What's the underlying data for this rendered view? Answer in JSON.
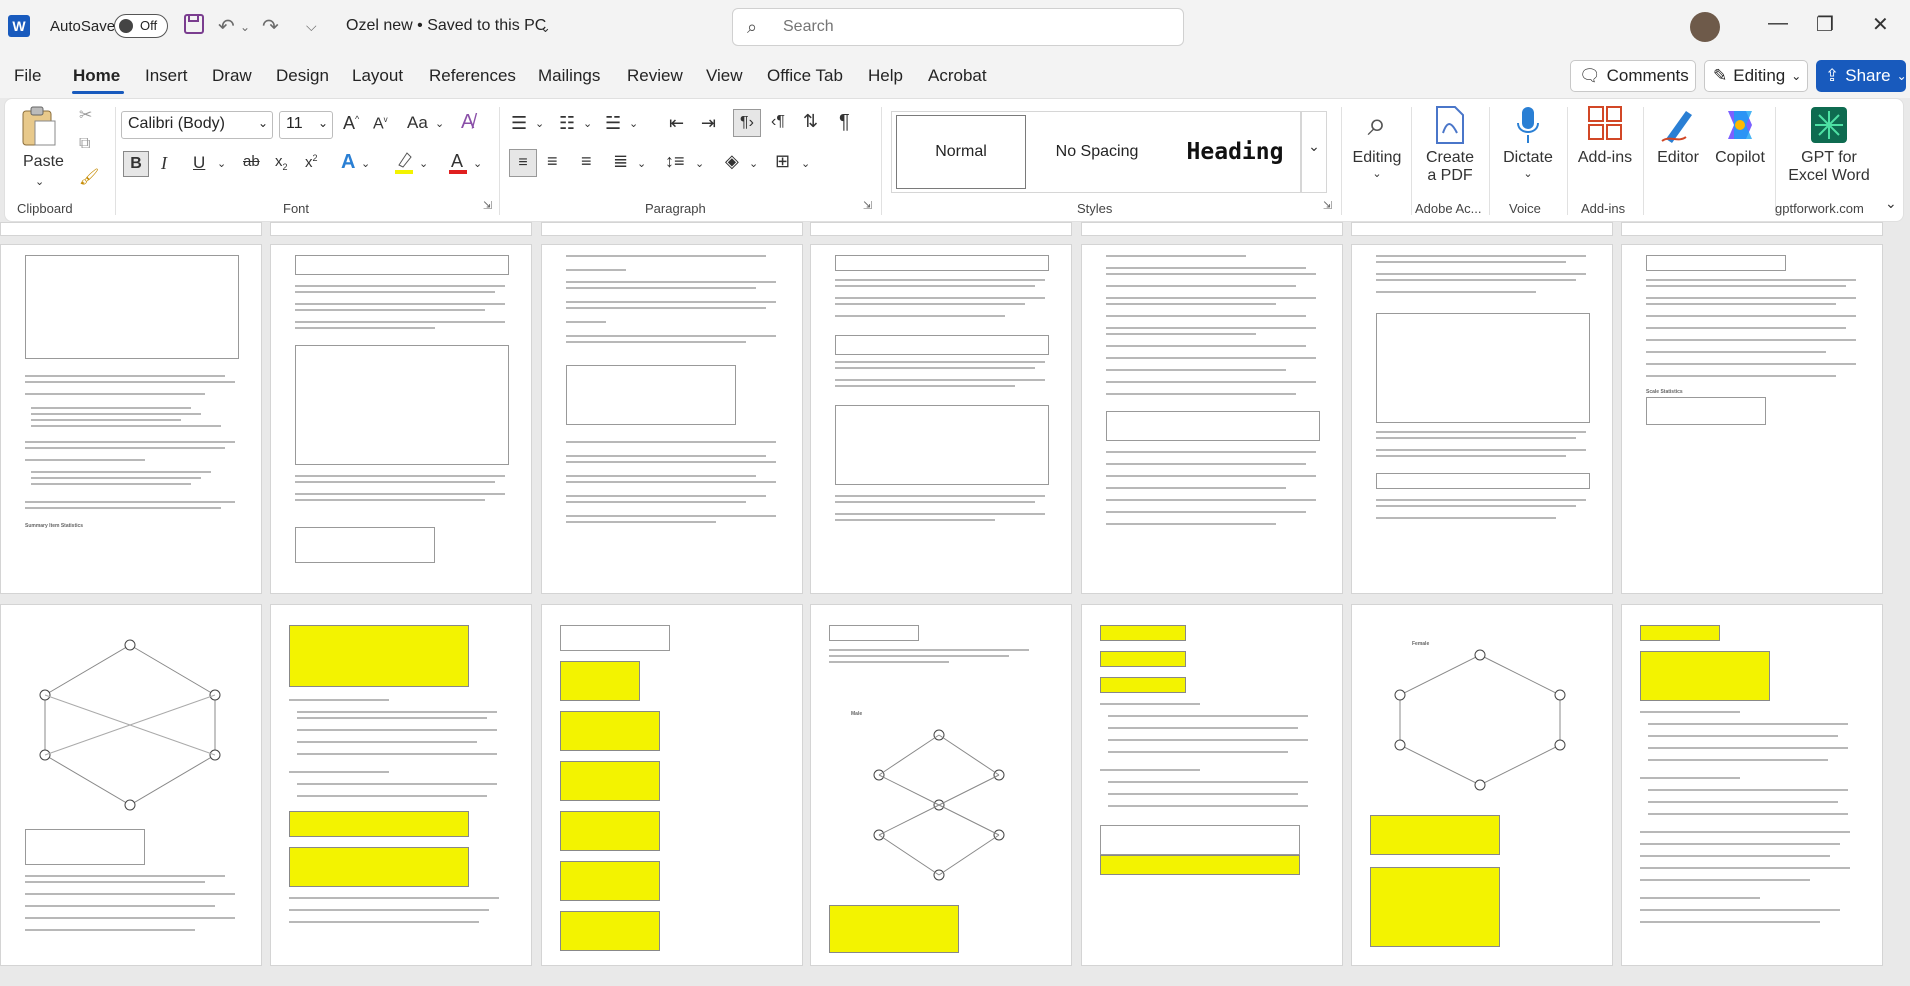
{
  "titlebar": {
    "autosave_label": "AutoSave",
    "autosave_state": "Off",
    "doc_title": "Ozel new • Saved to this PC",
    "search_placeholder": "Search"
  },
  "menu": {
    "tabs": [
      "File",
      "Home",
      "Insert",
      "Draw",
      "Design",
      "Layout",
      "References",
      "Mailings",
      "Review",
      "View",
      "Office Tab",
      "Help",
      "Acrobat"
    ],
    "active": "Home",
    "comments_label": "Comments",
    "editing_label": "Editing",
    "share_label": "Share"
  },
  "ribbon": {
    "clipboard": {
      "paste_label": "Paste",
      "group_label": "Clipboard"
    },
    "font": {
      "font_name": "Calibri (Body)",
      "font_size": "11",
      "group_label": "Font"
    },
    "paragraph": {
      "group_label": "Paragraph"
    },
    "styles": {
      "items": [
        "Normal",
        "No Spacing",
        "Heading"
      ],
      "group_label": "Styles"
    },
    "editing": {
      "label": "Editing"
    },
    "adobe": {
      "create_pdf_line1": "Create",
      "create_pdf_line2": "a PDF",
      "group_label": "Adobe Ac..."
    },
    "voice": {
      "dictate_label": "Dictate",
      "group_label": "Voice"
    },
    "addins": {
      "label": "Add-ins",
      "group_label": "Add-ins"
    },
    "editor_label": "Editor",
    "copilot_label": "Copilot",
    "gpt": {
      "line1": "GPT for",
      "line2": "Excel Word",
      "group_label": "gptforwork.com"
    }
  },
  "colors": {
    "accent": "#185abd",
    "highlight": "#f3f300",
    "font_red": "#e02020"
  },
  "page_snippets": {
    "p1_heading": "Summary Item Statistics",
    "p7_heading": "Scale Statistics",
    "p10_label": "Male",
    "p12_label": "Female"
  }
}
